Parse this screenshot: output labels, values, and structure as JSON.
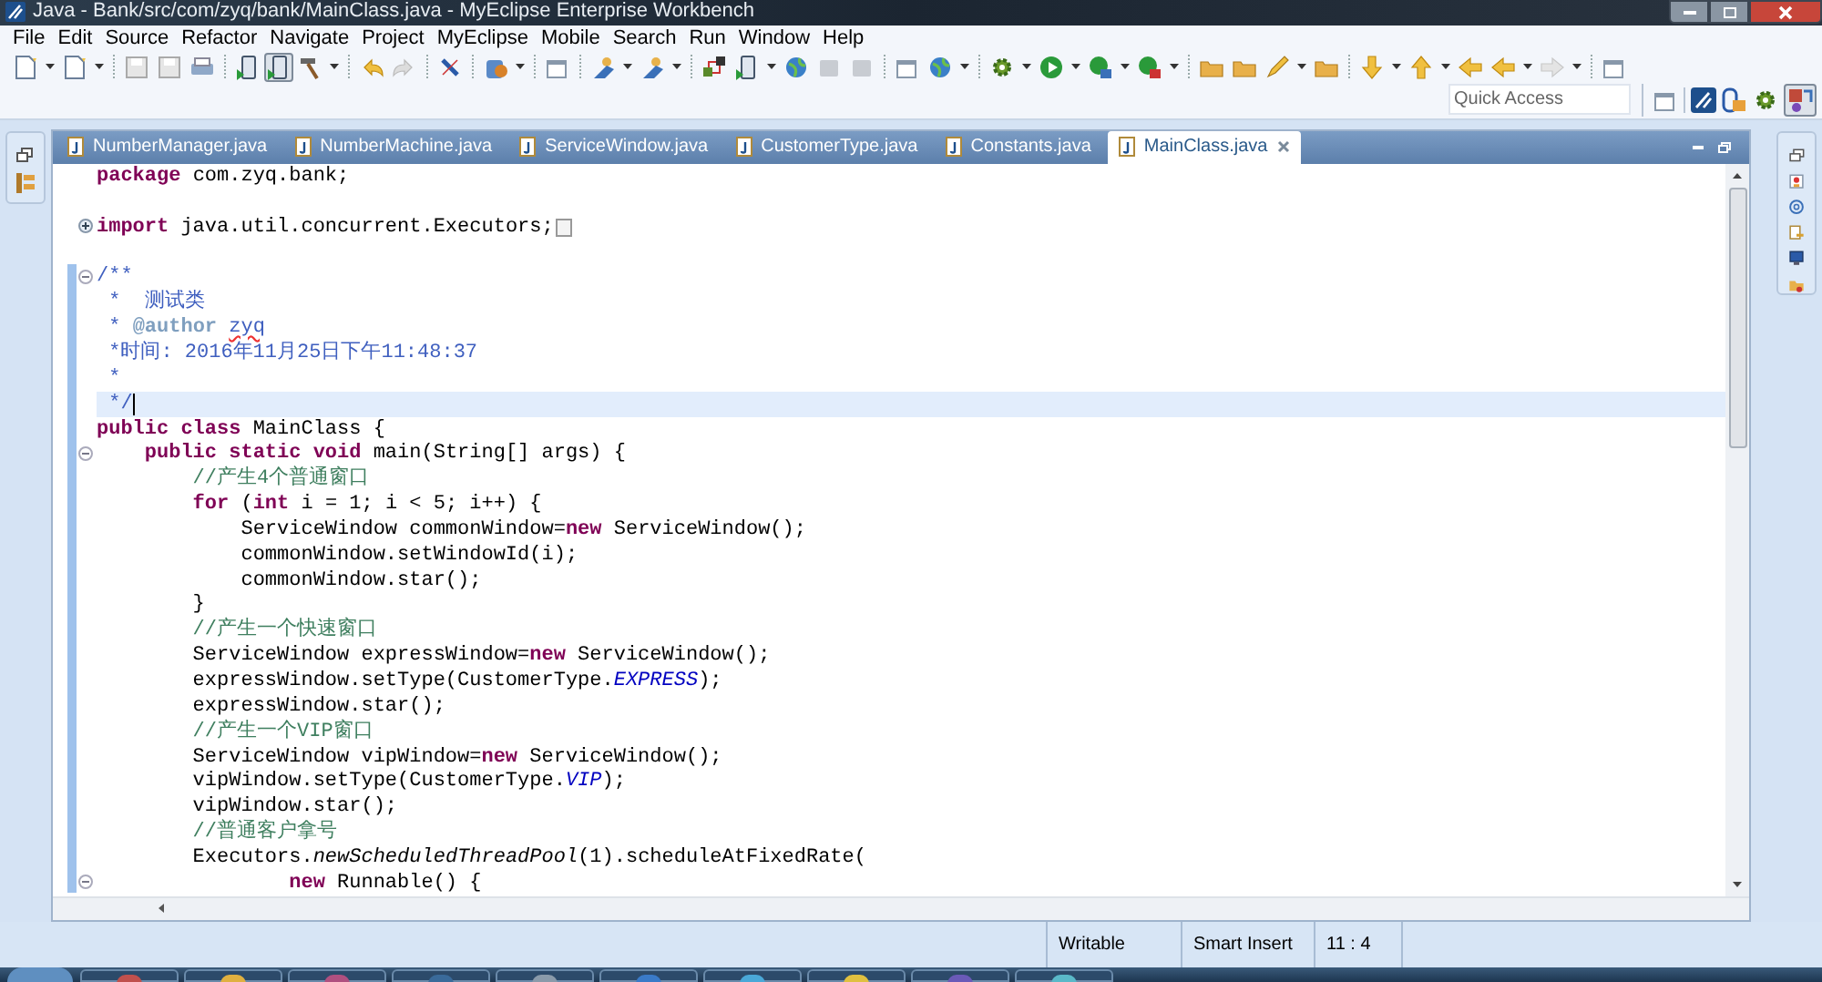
{
  "window": {
    "title": "Java - Bank/src/com/zyq/bank/MainClass.java - MyEclipse Enterprise Workbench"
  },
  "menu": [
    "File",
    "Edit",
    "Source",
    "Refactor",
    "Navigate",
    "Project",
    "MyEclipse",
    "Mobile",
    "Search",
    "Run",
    "Window",
    "Help"
  ],
  "quick_access": {
    "placeholder": "Quick Access"
  },
  "tabs": [
    {
      "label": "NumberManager.java",
      "selected": false
    },
    {
      "label": "NumberMachine.java",
      "selected": false
    },
    {
      "label": "ServiceWindow.java",
      "selected": false
    },
    {
      "label": "CustomerType.java",
      "selected": false
    },
    {
      "label": "Constants.java",
      "selected": false
    },
    {
      "label": "MainClass.java",
      "selected": true
    }
  ],
  "code_lines": [
    {
      "current": false,
      "tokens": [
        {
          "kind": "keyword",
          "text": "package"
        },
        {
          "kind": "plain",
          "text": " com.zyq.bank;"
        }
      ]
    },
    {
      "current": false
    },
    {
      "current": false,
      "collapsed": true,
      "tokens": [
        {
          "kind": "keyword",
          "text": "import"
        },
        {
          "kind": "plain",
          "text": " java.util.concurrent.Executors;"
        }
      ]
    },
    {
      "current": false
    },
    {
      "current": false,
      "collapsed": false,
      "tokens": [
        {
          "kind": "doc",
          "text": "/**"
        }
      ]
    },
    {
      "current": false,
      "tokens": [
        {
          "kind": "doc",
          "text": " *  测试类"
        }
      ]
    },
    {
      "current": false,
      "tokens": [
        {
          "kind": "doc",
          "text": " * "
        },
        {
          "kind": "doctag",
          "text": "@author "
        },
        {
          "kind": "misspelled",
          "text": "zyq"
        }
      ]
    },
    {
      "current": false,
      "tokens": [
        {
          "kind": "doc",
          "text": " *时间: 2016年11月25日下午11:48:37"
        }
      ]
    },
    {
      "current": false,
      "tokens": [
        {
          "kind": "doc",
          "text": " *"
        }
      ]
    },
    {
      "current": true,
      "tokens": [
        {
          "kind": "doc",
          "text": " */"
        }
      ]
    },
    {
      "current": false,
      "tokens": [
        {
          "kind": "keyword",
          "text": "public class"
        },
        {
          "kind": "plain",
          "text": " MainClass {"
        }
      ]
    },
    {
      "current": false,
      "collapsed": false,
      "tokens": [
        {
          "kind": "keyword",
          "text": "    public static void"
        },
        {
          "kind": "plain",
          "text": " main(String[] args) {"
        }
      ]
    },
    {
      "current": false,
      "tokens": [
        {
          "kind": "comment",
          "text": "        //产生4个普通窗口"
        }
      ]
    },
    {
      "current": false,
      "tokens": [
        {
          "kind": "keyword",
          "text": "        for"
        },
        {
          "kind": "plain",
          "text": " ("
        },
        {
          "kind": "keyword",
          "text": "int"
        },
        {
          "kind": "plain",
          "text": " i = 1; i < 5; i++) {"
        }
      ]
    },
    {
      "current": false,
      "tokens": [
        {
          "kind": "plain",
          "text": "            ServiceWindow commonWindow="
        },
        {
          "kind": "keyword",
          "text": "new"
        },
        {
          "kind": "plain",
          "text": " ServiceWindow();"
        }
      ]
    },
    {
      "current": false,
      "tokens": [
        {
          "kind": "plain",
          "text": "            commonWindow.setWindowId(i);"
        }
      ]
    },
    {
      "current": false,
      "tokens": [
        {
          "kind": "plain",
          "text": "            commonWindow.star();"
        }
      ]
    },
    {
      "current": false,
      "tokens": [
        {
          "kind": "plain",
          "text": "        }"
        }
      ]
    },
    {
      "current": false,
      "tokens": [
        {
          "kind": "comment",
          "text": "        //产生一个快速窗口"
        }
      ]
    },
    {
      "current": false,
      "tokens": [
        {
          "kind": "plain",
          "text": "        ServiceWindow expressWindow="
        },
        {
          "kind": "keyword",
          "text": "new"
        },
        {
          "kind": "plain",
          "text": " ServiceWindow();"
        }
      ]
    },
    {
      "current": false,
      "tokens": [
        {
          "kind": "plain",
          "text": "        expressWindow.setType(CustomerType."
        },
        {
          "kind": "static_field",
          "text": "EXPRESS"
        },
        {
          "kind": "plain",
          "text": ");"
        }
      ]
    },
    {
      "current": false,
      "tokens": [
        {
          "kind": "plain",
          "text": "        expressWindow.star();"
        }
      ]
    },
    {
      "current": false,
      "tokens": [
        {
          "kind": "comment",
          "text": "        //产生一个VIP窗口"
        }
      ]
    },
    {
      "current": false,
      "tokens": [
        {
          "kind": "plain",
          "text": "        ServiceWindow vipWindow="
        },
        {
          "kind": "keyword",
          "text": "new"
        },
        {
          "kind": "plain",
          "text": " ServiceWindow();"
        }
      ]
    },
    {
      "current": false,
      "tokens": [
        {
          "kind": "plain",
          "text": "        vipWindow.setType(CustomerType."
        },
        {
          "kind": "static_field",
          "text": "VIP"
        },
        {
          "kind": "plain",
          "text": ");"
        }
      ]
    },
    {
      "current": false,
      "tokens": [
        {
          "kind": "plain",
          "text": "        vipWindow.star();"
        }
      ]
    },
    {
      "current": false,
      "tokens": [
        {
          "kind": "comment",
          "text": "        //普通客户拿号"
        }
      ]
    },
    {
      "current": false,
      "tokens": [
        {
          "kind": "plain",
          "text": "        Executors."
        },
        {
          "kind": "static_method",
          "text": "newScheduledThreadPool"
        },
        {
          "kind": "plain",
          "text": "(1).scheduleAtFixedRate("
        }
      ]
    },
    {
      "current": false,
      "collapsed": false,
      "tokens": [
        {
          "kind": "keyword",
          "text": "                new"
        },
        {
          "kind": "plain",
          "text": " Runnable() {"
        }
      ]
    }
  ],
  "status_bar": [
    "Writable",
    "Smart Insert",
    "11 : 4"
  ]
}
